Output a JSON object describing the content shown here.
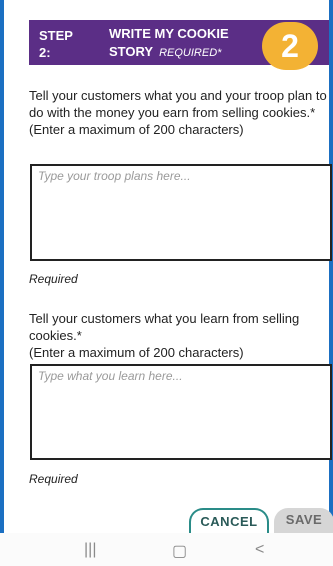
{
  "header": {
    "step_line1": "STEP",
    "step_line2": "2:",
    "title_line1": "WRITE MY COOKIE",
    "title_line2": "STORY",
    "required_tag": "REQUIRED*",
    "badge_number": "2"
  },
  "section1": {
    "prompt": "Tell your customers what you and your troop plan to do with the money you earn from selling cookies.*",
    "limit": "(Enter a maximum of 200 characters)",
    "placeholder": "Type your troop plans here...",
    "required_note": "Required"
  },
  "section2": {
    "prompt": "Tell your customers what you learn from selling cookies.*",
    "limit": "(Enter a maximum of 200 characters)",
    "placeholder": "Type what you learn here...",
    "required_note": "Required"
  },
  "buttons": {
    "cancel": "CANCEL",
    "save": "SAVE"
  },
  "colors": {
    "header_bg": "#5b2e86",
    "badge_bg": "#f3b234",
    "cancel_border": "#2a8c88",
    "save_bg": "#d6d6d6",
    "frame": "#1b6fc2"
  },
  "navbar": {
    "recent_glyph": "|||",
    "home_glyph": "▢",
    "back_glyph": "<"
  }
}
